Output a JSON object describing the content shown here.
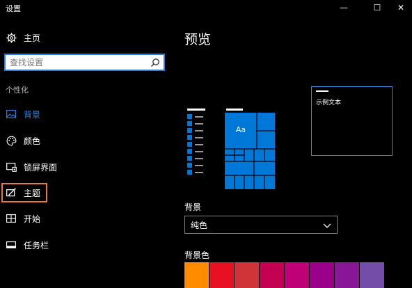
{
  "window": {
    "title": "设置",
    "min_glyph": "—",
    "max_glyph": "☐",
    "close_glyph": "✕"
  },
  "sidebar": {
    "home_label": "主页",
    "search_placeholder": "查找设置",
    "section_title": "个性化",
    "items": [
      {
        "label": "背景",
        "icon": "picture-icon",
        "active": true
      },
      {
        "label": "颜色",
        "icon": "palette-icon"
      },
      {
        "label": "锁屏界面",
        "icon": "lock-screen-icon"
      },
      {
        "label": "主题",
        "icon": "theme-brush-icon",
        "focused": true
      },
      {
        "label": "开始",
        "icon": "start-grid-icon"
      },
      {
        "label": "任务栏",
        "icon": "taskbar-icon"
      }
    ]
  },
  "main": {
    "title": "预览",
    "preview": {
      "tile_text": "Aa",
      "sample_text": "示例文本"
    },
    "background_label": "背景",
    "background_value": "纯色",
    "background_color_label": "背景色",
    "swatches": [
      "#ff8c00",
      "#e81123",
      "#d13438",
      "#c30052",
      "#bf0077",
      "#9a0089",
      "#881798",
      "#744da9"
    ]
  },
  "colors": {
    "accent": "#0078d7",
    "active_text": "#2f86e8",
    "focus_border": "#e87a35"
  }
}
